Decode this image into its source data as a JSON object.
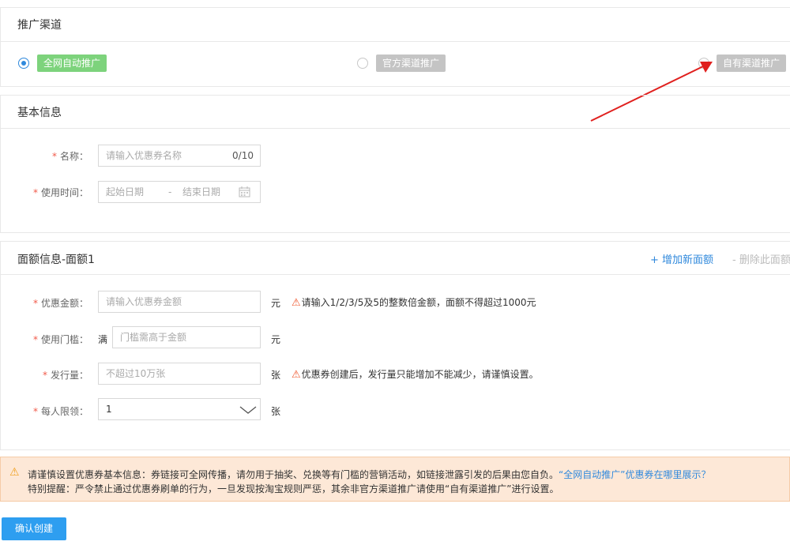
{
  "channel": {
    "title": "推广渠道",
    "options": [
      {
        "label": "全网自动推广",
        "selected": true
      },
      {
        "label": "官方渠道推广",
        "selected": false
      },
      {
        "label": "自有渠道推广",
        "selected": false
      }
    ]
  },
  "basic": {
    "title": "基本信息",
    "name": {
      "label": "名称：",
      "placeholder": "请输入优惠券名称",
      "counter": "0/10"
    },
    "time": {
      "label": "使用时间：",
      "start_placeholder": "起始日期",
      "separator": "-",
      "end_placeholder": "结束日期"
    }
  },
  "denomination": {
    "title": "面额信息-面额1",
    "add_link": "+ 增加新面额",
    "delete_link": "- 删除此面额",
    "amount": {
      "label": "优惠金额：",
      "placeholder": "请输入优惠券金额",
      "unit": "元",
      "hint": "请输入1/2/3/5及5的整数倍金额，面额不得超过1000元"
    },
    "threshold": {
      "label": "使用门槛：",
      "prefix": "满",
      "placeholder": "门槛需高于金额",
      "unit": "元"
    },
    "quantity": {
      "label": "发行量：",
      "placeholder": "不超过10万张",
      "unit": "张",
      "hint": "优惠券创建后，发行量只能增加不能减少，请谨慎设置。"
    },
    "limit": {
      "label": "每人限领：",
      "value": "1",
      "unit": "张"
    }
  },
  "notice": {
    "line1_text": "请谨慎设置优惠券基本信息：券链接可全网传播，请勿用于抽奖、兑换等有门槛的营销活动，如链接泄露引发的后果由您自负。",
    "line1_link": "“全网自动推广”优惠券在哪里展示？",
    "line2_text": "特别提醒：严令禁止通过优惠券刷单的行为，一旦发现按淘宝规则严惩，其余非官方渠道推广请使用“自有渠道推广”进行设置。"
  },
  "submit_label": "确认创建",
  "colors": {
    "accent": "#3089dc",
    "green_tag": "#7dd37c",
    "gray_tag": "#c4c4c4",
    "required": "#f15a4a",
    "arrow": "#e0201e",
    "notice_bg": "#fde8d7"
  }
}
